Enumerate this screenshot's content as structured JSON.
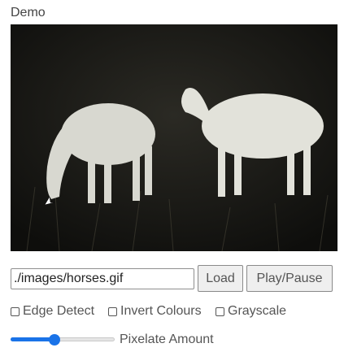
{
  "demo": {
    "title": "Demo"
  },
  "canvas": {
    "image_description_icon": "horses-image"
  },
  "url_field": {
    "value": "./images/horses.gif"
  },
  "buttons": {
    "load_label": "Load",
    "play_pause_label": "Play/Pause"
  },
  "options": [
    {
      "label": "Edge Detect",
      "checked": false
    },
    {
      "label": "Invert Colours",
      "checked": false
    },
    {
      "label": "Grayscale",
      "checked": false
    }
  ],
  "pixelate": {
    "label": "Pixelate Amount",
    "value_fraction": 0.42
  },
  "colors": {
    "accent": "#1a73e8"
  }
}
